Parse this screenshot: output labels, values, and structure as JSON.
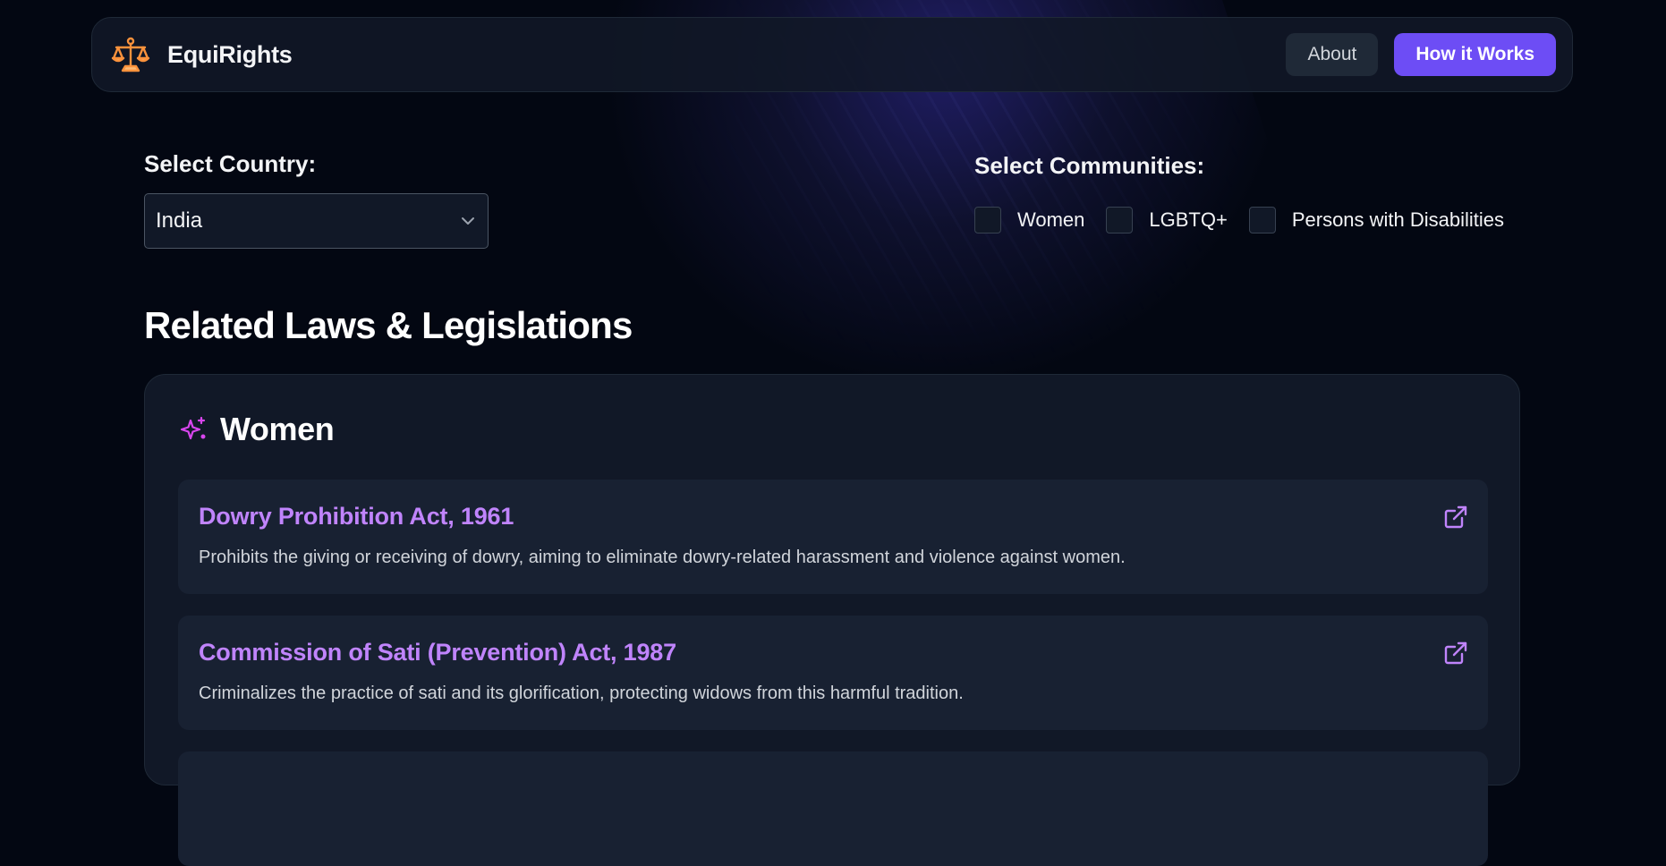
{
  "colors": {
    "background": "#030712",
    "accent": "#6d4df5",
    "law_title": "#c084fc",
    "sparkle_icon": "#d946ef",
    "logo": "#fb923c"
  },
  "navbar": {
    "brand": "EquiRights",
    "logo_icon": "scales-of-justice-icon",
    "about_label": "About",
    "how_label": "How it Works"
  },
  "country": {
    "label": "Select Country:",
    "selected": "India",
    "icon": "chevron-down-icon"
  },
  "communities": {
    "label": "Select Communities:",
    "options": [
      {
        "label": "Women",
        "checked": false
      },
      {
        "label": "LGBTQ+",
        "checked": false
      },
      {
        "label": "Persons with Disabilities",
        "checked": false
      }
    ]
  },
  "main": {
    "heading": "Related Laws & Legislations",
    "section": {
      "title": "Women",
      "icon": "sparkles-icon",
      "laws": [
        {
          "title": "Dowry Prohibition Act, 1961",
          "description": "Prohibits the giving or receiving of dowry, aiming to eliminate dowry-related harassment and violence against women.",
          "link_icon": "external-link-icon"
        },
        {
          "title": "Commission of Sati (Prevention) Act, 1987",
          "description": "Criminalizes the practice of sati and its glorification, protecting widows from this harmful tradition.",
          "link_icon": "external-link-icon"
        }
      ]
    }
  }
}
